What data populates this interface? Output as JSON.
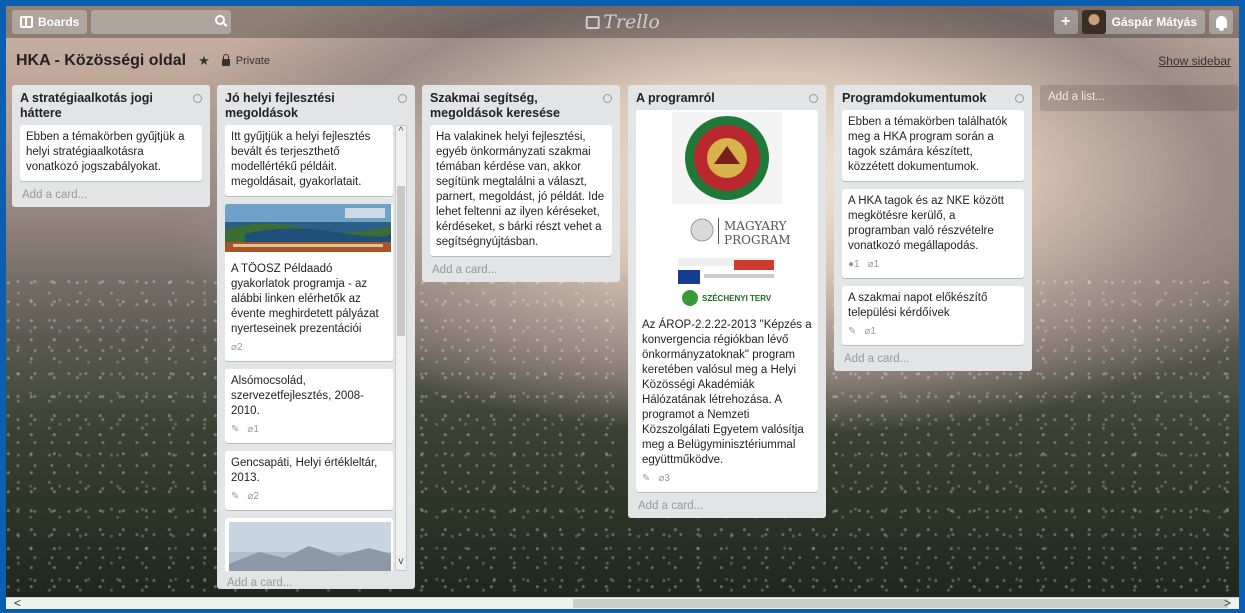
{
  "header": {
    "boards_label": "Boards",
    "search_placeholder": "",
    "logo_text": "Trello",
    "user_name": "Gáspár Mátyás"
  },
  "board": {
    "title": "HKA - Közösségi oldal",
    "privacy": "Private",
    "show_sidebar": "Show sidebar"
  },
  "lists": [
    {
      "title": "A stratégiaalkotás jogi háttere",
      "cards": [
        {
          "text": "Ebben a témakörben gyűjtjük a helyi stratégiaalkotásra vonatkozó jogszabályokat."
        }
      ],
      "add_card": "Add a card..."
    },
    {
      "title": "Jó helyi fejlesztési megoldások",
      "cards": [
        {
          "text": "Itt gyűjtjük a helyi fejlesztés bevált és terjeszthető modellértékű példáit. megoldásait, gyakorlatait."
        },
        {
          "text": "A TÖOSZ Példaadó gyakorlatok programja - az alábbi linken elérhetők az évente meghirdetett pályázat nyerteseinek prezentációi",
          "attachments": "2"
        },
        {
          "text": "Alsómocsolád, szervezetfejlesztés, 2008-2010.",
          "attachments": "1"
        },
        {
          "text": "Gencsapáti, Helyi értékleltár, 2013.",
          "attachments": "2"
        }
      ],
      "add_card": "Add a card..."
    },
    {
      "title": "Szakmai segítség, megoldások keresése",
      "cards": [
        {
          "text": "Ha valakinek helyi fejlesztési, egyéb önkormányzati szakmai témában kérdése van, akkor segítünk megtalálni a választ, parnert, megoldást, jó példát. Ide lehet feltenni az ilyen kéréseket, kérdéseket, s bárki részt vehet a segítségnyújtásban."
        }
      ],
      "add_card": "Add a card..."
    },
    {
      "title": "A programról",
      "cards": [
        {
          "text": "Az ÁROP-2.2.22-2013 \"Képzés a konvergencia régiókban lévő önkormányzatoknak\" program keretében valósul meg a Helyi Közösségi Akadémiák Hálózatának létrehozása. A programot a Nemzeti Közszolgálati Egyetem valósítja meg a Belügyminisztériummal együttműködve.",
          "attachments": "3"
        }
      ],
      "image_text": {
        "seal": "NEMZETI KÖZSZOLGÁLATI EGYETEM · HAZA SZOLGÁLATÁBAN",
        "magyary_1": "MAGYARY",
        "magyary_2": "PROGRAM",
        "szechenyi": "SZÉCHENYI TERV"
      },
      "add_card": "Add a card..."
    },
    {
      "title": "Programdokumentumok",
      "cards": [
        {
          "text": "Ebben a témakörben találhatók meg a HKA program során a tagok számára készített, közzétett dokumentumok."
        },
        {
          "text": "A HKA tagok és az NKE között megkötésre kerülő, a programban való részvételre vonatkozó megállapodás.",
          "comments": "1",
          "attachments": "1"
        },
        {
          "text": "A szakmai napot előkészítő települési kérdőívek",
          "attachments": "1"
        }
      ],
      "add_card": "Add a card..."
    }
  ],
  "add_list": "Add a list...",
  "icons": [
    "boards-icon",
    "search-icon",
    "trello-logo-icon",
    "plus-icon",
    "bell-icon",
    "star-icon",
    "lock-icon",
    "list-menu-icon",
    "paperclip-icon",
    "pencil-icon",
    "comment-icon"
  ]
}
